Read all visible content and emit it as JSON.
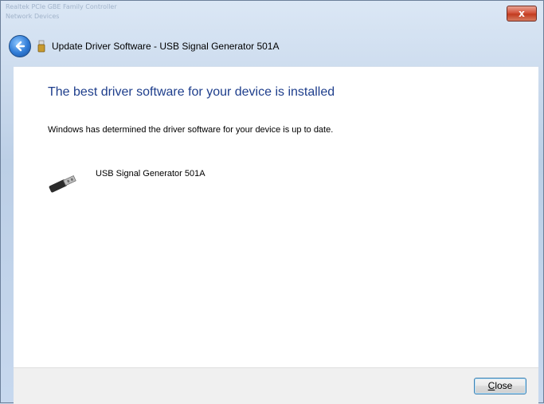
{
  "background": {
    "lines": [
      "Realtek PCIe GBE Family Controller",
      "Network Devices"
    ]
  },
  "window": {
    "close_label": "x",
    "title": "Update Driver Software - USB Signal Generator 501A"
  },
  "content": {
    "heading": "The best driver software for your device is installed",
    "description": "Windows has determined the driver software for your device is up to date.",
    "device_name": "USB Signal Generator 501A"
  },
  "footer": {
    "close_button_accel": "C",
    "close_button_rest": "lose"
  },
  "colors": {
    "heading": "#1e3e8c",
    "accent_blue": "#2f7bd6",
    "close_red": "#c23b20"
  },
  "icons": [
    "back-arrow-icon",
    "usb-icon",
    "usb-device-icon",
    "window-close-icon"
  ]
}
